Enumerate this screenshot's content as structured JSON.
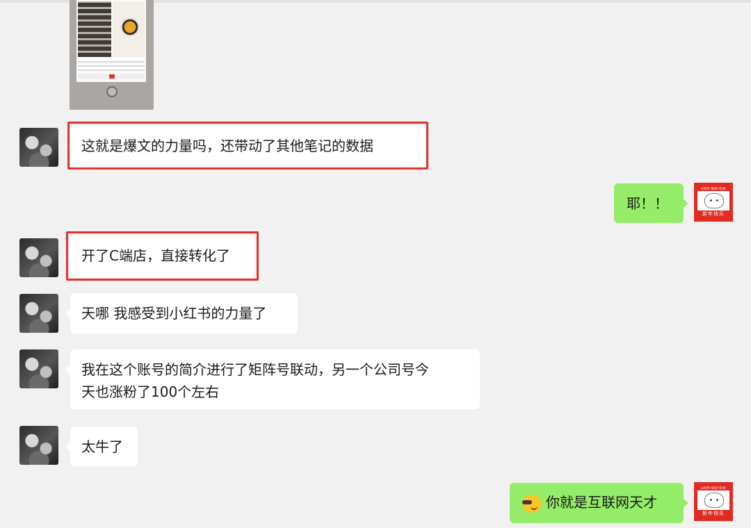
{
  "photo": {
    "icon": "phone-screenshot-image"
  },
  "messages": [
    {
      "sender": "other",
      "text": "这就是爆文的力量吗，还带动了其他笔记的数据",
      "highlighted": true
    },
    {
      "sender": "self",
      "text": "耶！！"
    },
    {
      "sender": "other",
      "text": "开了C端店，直接转化了",
      "highlighted": true
    },
    {
      "sender": "other",
      "text": "天哪 我感受到小红书的力量了"
    },
    {
      "sender": "other",
      "lines": [
        "我在这个账号的简介进行了矩阵号联动，另一个公司号今",
        "天也涨粉了100个左右"
      ]
    },
    {
      "sender": "other",
      "text": "太牛了"
    },
    {
      "sender": "self",
      "text": "你就是互联网天才",
      "emoji": "sunglasses-emoji-icon"
    }
  ],
  "self_avatar": {
    "top_text": "HAPPY NEW YEAR",
    "banner": "新年快乐"
  },
  "colors": {
    "self_bubble": "#95ec69",
    "other_bubble": "#ffffff",
    "highlight": "#e0322c",
    "background": "#f1f1f1"
  }
}
